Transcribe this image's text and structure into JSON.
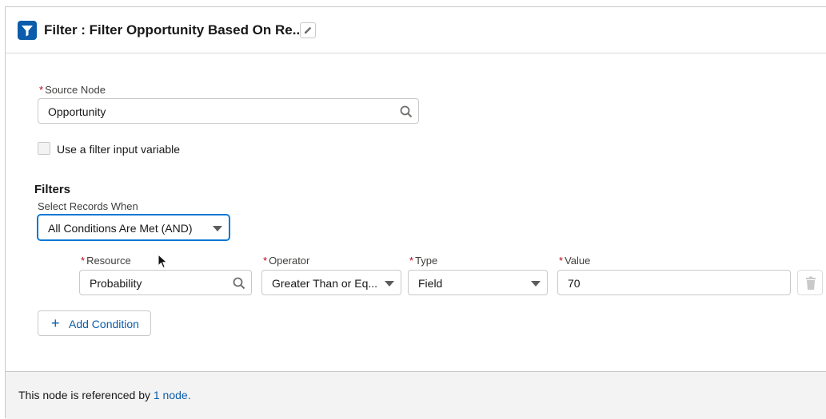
{
  "header": {
    "title": "Filter :  Filter Opportunity Based On Re...",
    "icon": "filter-icon",
    "edit_icon": "pencil-icon"
  },
  "source_node": {
    "label": "Source Node",
    "value": "Opportunity",
    "icon": "search-icon"
  },
  "filter_input_variable": {
    "label": "Use a filter input variable",
    "checked": false
  },
  "filters": {
    "title": "Filters",
    "select_label": "Select Records When",
    "select_value": "All Conditions Are Met (AND)",
    "condition": {
      "resource_label": "Resource",
      "resource_value": "Probability",
      "operator_label": "Operator",
      "operator_value": "Greater Than or Eq...",
      "type_label": "Type",
      "type_value": "Field",
      "value_label": "Value",
      "value_value": "70",
      "delete_icon": "trash-icon"
    },
    "add_condition_label": "Add Condition"
  },
  "footer": {
    "text": "This node is referenced by",
    "link": "1 node."
  },
  "colors": {
    "brand_blue": "#0b5cab",
    "focus_blue": "#0176d3",
    "required_red": "#ba0517",
    "footer_bg": "#f3f3f3"
  }
}
